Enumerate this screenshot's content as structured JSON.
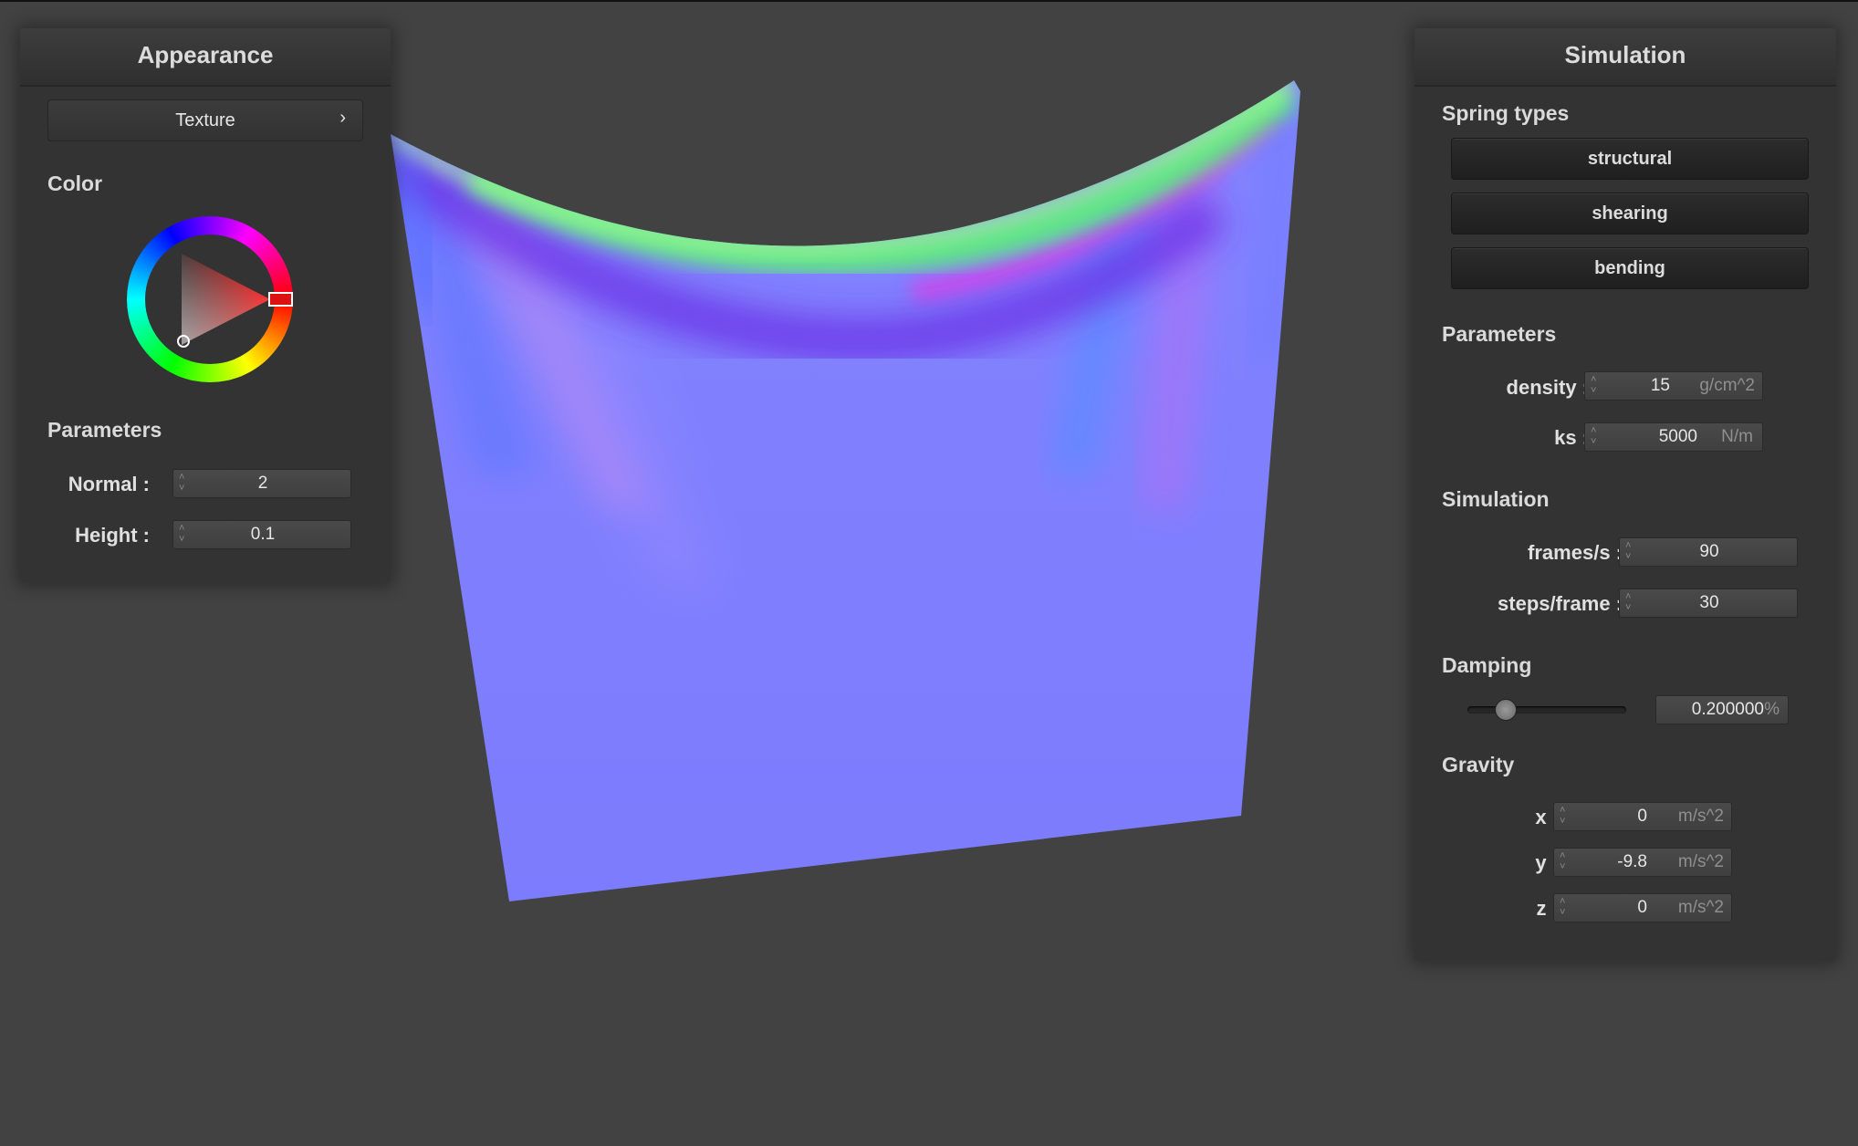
{
  "appearance": {
    "title": "Appearance",
    "texture_button": "Texture",
    "texture_chevron": "›",
    "color_heading": "Color",
    "color_value": "#ff0000",
    "parameters_heading": "Parameters",
    "normal": {
      "label": "Normal :",
      "value": "2"
    },
    "height": {
      "label": "Height :",
      "value": "0.1"
    }
  },
  "simulation": {
    "title": "Simulation",
    "spring_types_heading": "Spring types",
    "spring_buttons": [
      "structural",
      "shearing",
      "bending"
    ],
    "parameters_heading": "Parameters",
    "density": {
      "label": "density :",
      "value": "15",
      "unit": "g/cm^2"
    },
    "ks": {
      "label": "ks :",
      "value": "5000",
      "unit": "N/m"
    },
    "simulation_heading": "Simulation",
    "frames": {
      "label": "frames/s :",
      "value": "90"
    },
    "steps": {
      "label": "steps/frame :",
      "value": "30"
    },
    "damping_heading": "Damping",
    "damping": {
      "value": "0.200000",
      "unit": "%",
      "slider_fraction": 0.2
    },
    "gravity_heading": "Gravity",
    "gravity": [
      {
        "label": "x :",
        "value": "0",
        "unit": "m/s^2"
      },
      {
        "label": "y :",
        "value": "-9.8",
        "unit": "m/s^2"
      },
      {
        "label": "z :",
        "value": "0",
        "unit": "m/s^2"
      }
    ]
  },
  "icons": {
    "spinner": "up-down-spinner-icon",
    "chevron": "chevron-right-icon"
  },
  "colors": {
    "background": "#424242",
    "panel": "#333333",
    "cloth_base": "#7f7ffe"
  }
}
